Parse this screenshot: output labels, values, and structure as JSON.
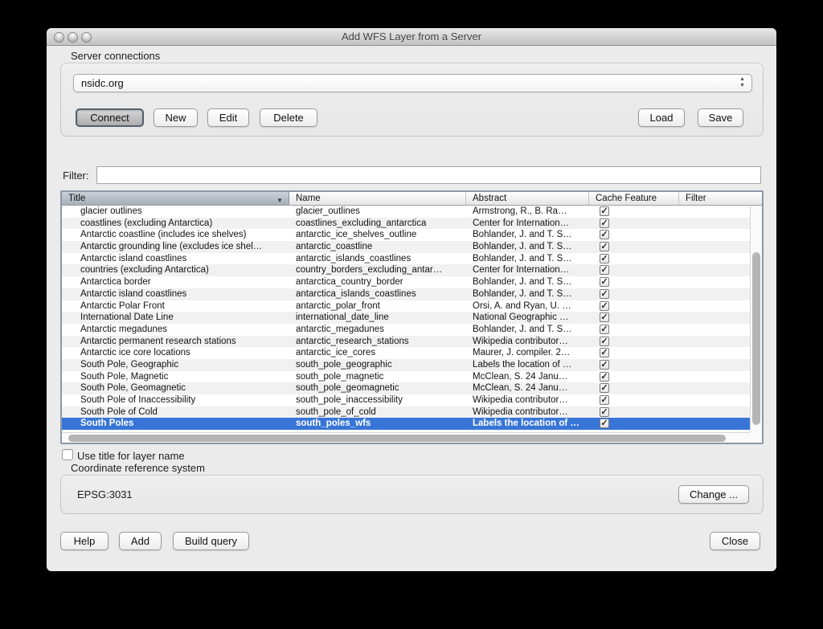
{
  "window": {
    "title": "Add WFS Layer from a Server"
  },
  "server_connections": {
    "group_label": "Server connections",
    "selected_connection": "nsidc.org",
    "connect_label": "Connect",
    "new_label": "New",
    "edit_label": "Edit",
    "delete_label": "Delete",
    "load_label": "Load",
    "save_label": "Save"
  },
  "filter": {
    "label": "Filter:",
    "value": "",
    "placeholder": ""
  },
  "table": {
    "columns": [
      "Title",
      "Name",
      "Abstract",
      "Cache Feature",
      "Filter"
    ],
    "sorted_column": "Title",
    "sort_direction": "descending",
    "selected_index": 18,
    "rows": [
      {
        "title": "glacier outlines",
        "name": "glacier_outlines",
        "abstract": "Armstrong, R., B. Ra…",
        "cache_feature": true
      },
      {
        "title": "coastlines (excluding Antarctica)",
        "name": "coastlines_excluding_antarctica",
        "abstract": "Center for Internation…",
        "cache_feature": true
      },
      {
        "title": "Antarctic coastline (includes ice shelves)",
        "name": "antarctic_ice_shelves_outline",
        "abstract": "Bohlander, J. and T. S…",
        "cache_feature": true
      },
      {
        "title": "Antarctic grounding line (excludes ice shel…",
        "name": "antarctic_coastline",
        "abstract": "Bohlander, J. and T. S…",
        "cache_feature": true
      },
      {
        "title": "Antarctic island coastlines",
        "name": "antarctic_islands_coastlines",
        "abstract": "Bohlander, J. and T. S…",
        "cache_feature": true
      },
      {
        "title": "countries (excluding Antarctica)",
        "name": "country_borders_excluding_antar…",
        "abstract": "Center for Internation…",
        "cache_feature": true
      },
      {
        "title": "Antarctica border",
        "name": "antarctica_country_border",
        "abstract": "Bohlander, J. and T. S…",
        "cache_feature": true
      },
      {
        "title": "Antarctic island coastlines",
        "name": "antarctica_islands_coastlines",
        "abstract": "Bohlander, J. and T. S…",
        "cache_feature": true
      },
      {
        "title": "Antarctic Polar Front",
        "name": "antarctic_polar_front",
        "abstract": "Orsi, A. and Ryan, U. …",
        "cache_feature": true
      },
      {
        "title": "International Date Line",
        "name": "international_date_line",
        "abstract": "National Geographic …",
        "cache_feature": true
      },
      {
        "title": "Antarctic megadunes",
        "name": "antarctic_megadunes",
        "abstract": "Bohlander, J. and T. S…",
        "cache_feature": true
      },
      {
        "title": "Antarctic permanent research stations",
        "name": "antarctic_research_stations",
        "abstract": "Wikipedia contributor…",
        "cache_feature": true
      },
      {
        "title": "Antarctic ice core locations",
        "name": "antarctic_ice_cores",
        "abstract": "Maurer, J. compiler. 2…",
        "cache_feature": true
      },
      {
        "title": "South Pole, Geographic",
        "name": "south_pole_geographic",
        "abstract": "Labels the location of …",
        "cache_feature": true
      },
      {
        "title": "South Pole, Magnetic",
        "name": "south_pole_magnetic",
        "abstract": "McClean, S. 24 Janu…",
        "cache_feature": true
      },
      {
        "title": "South Pole, Geomagnetic",
        "name": "south_pole_geomagnetic",
        "abstract": "McClean, S. 24 Janu…",
        "cache_feature": true
      },
      {
        "title": "South Pole of Inaccessibility",
        "name": "south_pole_inaccessibility",
        "abstract": "Wikipedia contributor…",
        "cache_feature": true
      },
      {
        "title": "South Pole of Cold",
        "name": "south_pole_of_cold",
        "abstract": "Wikipedia contributor…",
        "cache_feature": true
      },
      {
        "title": "South Poles",
        "name": "south_poles_wfs",
        "abstract": "Labels the location of …",
        "cache_feature": true
      }
    ]
  },
  "options": {
    "use_title_label": "Use title for layer name",
    "use_title_checked": false
  },
  "crs": {
    "group_label": "Coordinate reference system",
    "value": "EPSG:3031",
    "change_label": "Change ..."
  },
  "footer": {
    "help_label": "Help",
    "add_label": "Add",
    "build_query_label": "Build query",
    "close_label": "Close"
  },
  "icons": {
    "sort": "▼",
    "check": "✓",
    "stepper_up": "▲",
    "stepper_down": "▼"
  },
  "colors": {
    "selection_blue": "#3875d7",
    "window_background": "#ebebeb",
    "sorted_header": "#a3adb9"
  }
}
